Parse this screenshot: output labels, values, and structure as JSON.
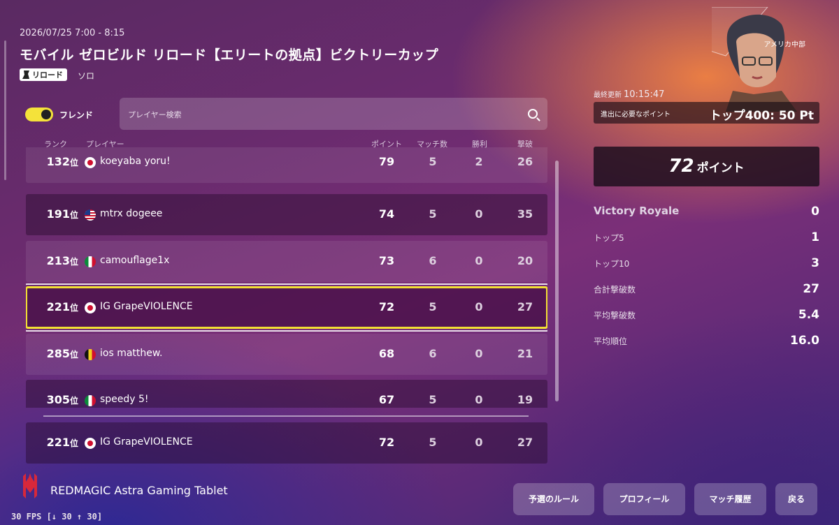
{
  "header": {
    "date": "2026/07/25 7:00 - 8:15",
    "title": "モバイル ゼロビルド リロード【エリートの拠点】ビクトリーカップ",
    "mode_badge": "リロード",
    "mode_sub": "ソロ"
  },
  "filters": {
    "friend_toggle_label": "フレンド",
    "friend_toggle_on": true,
    "search_placeholder": "プレイヤー検索"
  },
  "columns": {
    "rank": "ランク",
    "player": "プレイヤー",
    "points": "ポイント",
    "matches": "マッチ数",
    "wins": "勝利",
    "eliminations": "撃破"
  },
  "rank_suffix": "位",
  "rows": [
    {
      "rank": "132",
      "flag": "jp",
      "name": "koeyaba yoru!",
      "points": "79",
      "matches": "5",
      "wins": "2",
      "elims": "26"
    },
    {
      "rank": "191",
      "flag": "us",
      "name": "mtrx dogeee",
      "points": "74",
      "matches": "5",
      "wins": "0",
      "elims": "35"
    },
    {
      "rank": "213",
      "flag": "it",
      "name": "camouflage1x",
      "points": "73",
      "matches": "6",
      "wins": "0",
      "elims": "20"
    },
    {
      "rank": "221",
      "flag": "jp",
      "name": "IG GrapeVIOLENCE",
      "points": "72",
      "matches": "5",
      "wins": "0",
      "elims": "27"
    },
    {
      "rank": "285",
      "flag": "be",
      "name": "ios matthew.",
      "points": "68",
      "matches": "6",
      "wins": "0",
      "elims": "21"
    },
    {
      "rank": "305",
      "flag": "it",
      "name": "speedy 5!",
      "points": "67",
      "matches": "5",
      "wins": "0",
      "elims": "19"
    }
  ],
  "pinned_row": {
    "rank": "221",
    "flag": "jp",
    "name": "IG GrapeVIOLENCE",
    "points": "72",
    "matches": "5",
    "wins": "0",
    "elims": "27"
  },
  "side": {
    "region": "アメリカ中部",
    "updated_label": "最終更新",
    "updated_time": "10:15:47",
    "needed_label": "進出に必要なポイント",
    "needed_value": "トップ400: 50 Pt",
    "points_value": "72",
    "points_unit": "ポイント",
    "stats": [
      {
        "label": "Victory Royale",
        "value": "0"
      },
      {
        "label": "トップ5",
        "value": "1"
      },
      {
        "label": "トップ10",
        "value": "3"
      },
      {
        "label": "合計撃破数",
        "value": "27"
      },
      {
        "label": "平均撃破数",
        "value": "5.4"
      },
      {
        "label": "平均順位",
        "value": "16.0"
      }
    ]
  },
  "footer": {
    "brand": "REDMAGIC Astra Gaming Tablet",
    "fps": "30 FPS [↓ 30 ↑ 30]",
    "buttons": {
      "rules": "予選のルール",
      "profile": "プロフィール",
      "history": "マッチ履歴",
      "back": "戻る"
    }
  },
  "colors": {
    "highlight": "#f2e033",
    "toggle": "#f4e23a"
  }
}
